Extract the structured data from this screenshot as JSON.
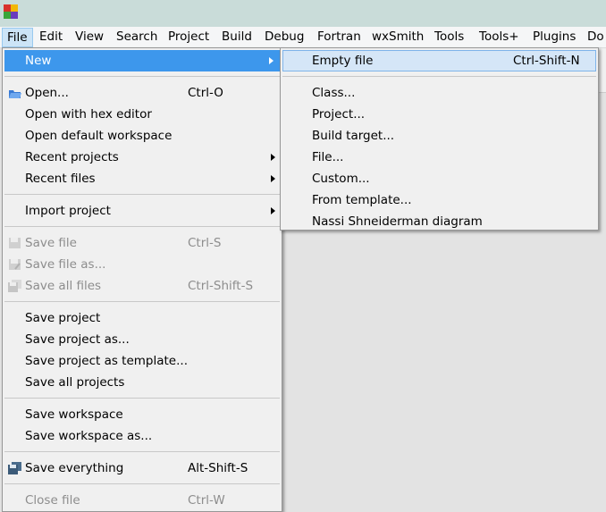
{
  "menubar": {
    "items": [
      "File",
      "Edit",
      "View",
      "Search",
      "Project",
      "Build",
      "Debug",
      "Fortran",
      "wxSmith",
      "Tools",
      "Tools+",
      "Plugins",
      "Do"
    ],
    "open": "File"
  },
  "file_menu": {
    "items": [
      {
        "label": "New",
        "submenu": true,
        "highlighted": true
      },
      {
        "sep": true
      },
      {
        "label": "Open...",
        "shortcut": "Ctrl-O",
        "icon": "open-folder-icon"
      },
      {
        "label": "Open with hex editor"
      },
      {
        "label": "Open default workspace"
      },
      {
        "label": "Recent projects",
        "submenu": true
      },
      {
        "label": "Recent files",
        "submenu": true
      },
      {
        "sep": true
      },
      {
        "label": "Import project",
        "submenu": true
      },
      {
        "sep": true
      },
      {
        "label": "Save file",
        "shortcut": "Ctrl-S",
        "disabled": true,
        "icon": "save-icon"
      },
      {
        "label": "Save file as...",
        "disabled": true,
        "icon": "save-as-icon"
      },
      {
        "label": "Save all files",
        "shortcut": "Ctrl-Shift-S",
        "disabled": true,
        "icon": "save-all-icon"
      },
      {
        "sep": true
      },
      {
        "label": "Save project"
      },
      {
        "label": "Save project as..."
      },
      {
        "label": "Save project as template..."
      },
      {
        "label": "Save all projects"
      },
      {
        "sep": true
      },
      {
        "label": "Save workspace"
      },
      {
        "label": "Save workspace as..."
      },
      {
        "sep": true
      },
      {
        "label": "Save everything",
        "shortcut": "Alt-Shift-S",
        "icon": "save-everything-icon"
      },
      {
        "sep": true
      },
      {
        "label": "Close file",
        "shortcut": "Ctrl-W",
        "disabled": true
      }
    ]
  },
  "new_submenu": {
    "items": [
      {
        "label": "Empty file",
        "shortcut": "Ctrl-Shift-N",
        "highlighted": true
      },
      {
        "sep": true
      },
      {
        "label": "Class..."
      },
      {
        "label": "Project..."
      },
      {
        "label": "Build target..."
      },
      {
        "label": "File..."
      },
      {
        "label": "Custom..."
      },
      {
        "label": "From template..."
      },
      {
        "label": "Nassi Shneiderman diagram"
      }
    ]
  },
  "colors": {
    "highlight": "#3d97ec",
    "submenu_highlight": "#d5e6f7"
  }
}
